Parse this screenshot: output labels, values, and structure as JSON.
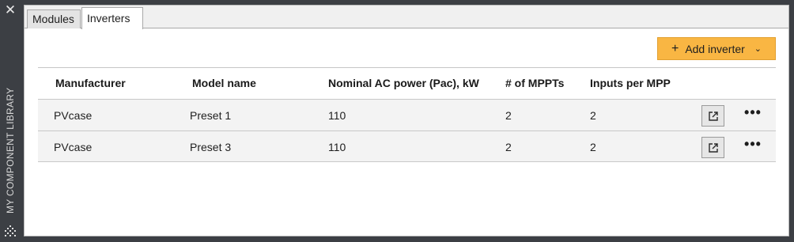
{
  "sidebar": {
    "title": "MY COMPONENT LIBRARY",
    "close_icon": "close-icon",
    "grip_icon": "grip-icon"
  },
  "tabs": [
    {
      "label": "Modules",
      "active": false
    },
    {
      "label": "Inverters",
      "active": true
    }
  ],
  "toolbar": {
    "add_label": "Add inverter",
    "add_icon": "plus-icon",
    "dropdown_icon": "chevron-down-icon",
    "accent_color": "#f9b643"
  },
  "table": {
    "columns": [
      "Manufacturer",
      "Model name",
      "Nominal AC power (Pac), kW",
      "# of MPPTs",
      "Inputs per MPP"
    ],
    "rows": [
      {
        "manufacturer": "PVcase",
        "model": "Preset 1",
        "pac": "110",
        "mppts": "2",
        "inputs": "2"
      },
      {
        "manufacturer": "PVcase",
        "model": "Preset 3",
        "pac": "110",
        "mppts": "2",
        "inputs": "2"
      }
    ],
    "row_actions": [
      "open-external-icon",
      "more-options-icon"
    ]
  }
}
